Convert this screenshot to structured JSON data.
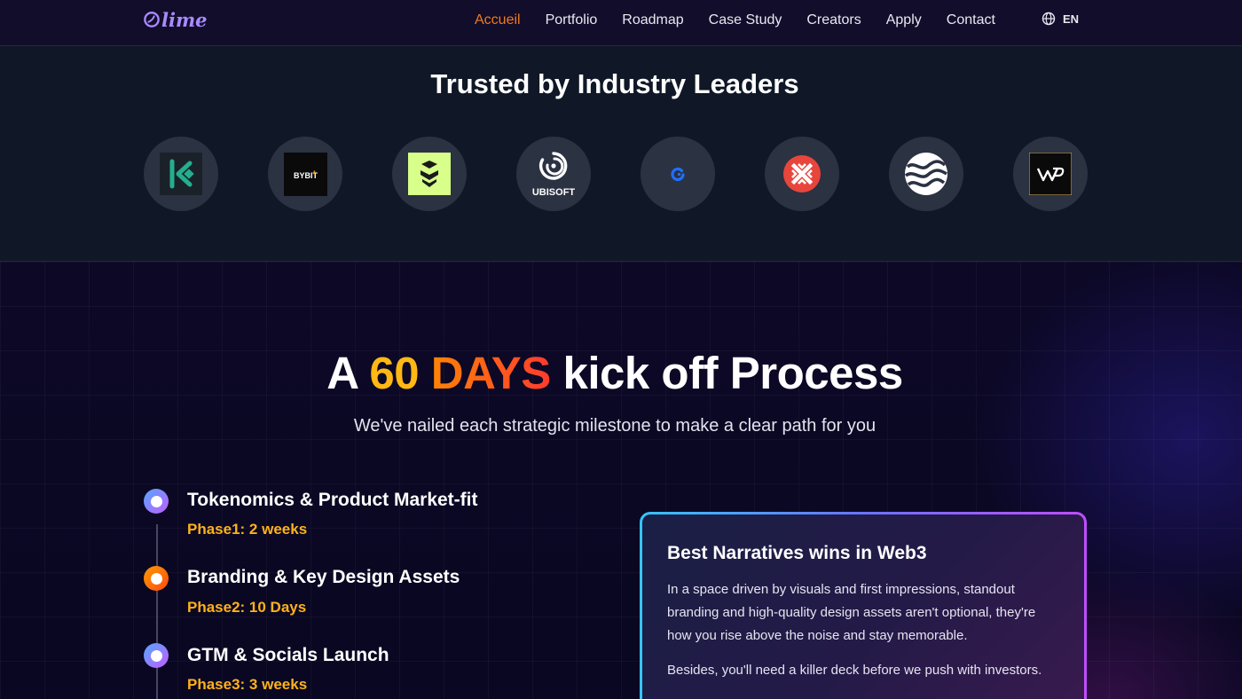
{
  "nav": {
    "logo": "lime",
    "links": [
      {
        "label": "Accueil",
        "active": true
      },
      {
        "label": "Portfolio"
      },
      {
        "label": "Roadmap"
      },
      {
        "label": "Case Study"
      },
      {
        "label": "Creators"
      },
      {
        "label": "Apply"
      },
      {
        "label": "Contact"
      }
    ],
    "language": {
      "icon": "globe-icon",
      "label": "EN"
    }
  },
  "trusted": {
    "title": "Trusted by Industry Leaders",
    "partners": [
      {
        "name": "kucoin-logo"
      },
      {
        "name": "bybit-logo",
        "text": "BYBIT"
      },
      {
        "name": "layered-chevron-logo"
      },
      {
        "name": "ubisoft-logo",
        "text": "UBISOFT"
      },
      {
        "name": "blue-ring-logo"
      },
      {
        "name": "red-x-logo"
      },
      {
        "name": "waves-logo"
      },
      {
        "name": "wp-monogram-logo"
      }
    ]
  },
  "process": {
    "headline": {
      "prefix": "A ",
      "num": "60",
      "days": " DAYS",
      "suffix": " kick off Process"
    },
    "subtitle": "We've nailed each strategic milestone to make a clear path for you",
    "steps": [
      {
        "title": "Tokenomics & Product Market-fit",
        "phase": "Phase1: 2 weeks",
        "color": "purple"
      },
      {
        "title": "Branding & Key Design Assets",
        "phase": "Phase2: 10 Days",
        "color": "orange"
      },
      {
        "title": "GTM & Socials Launch",
        "phase": "Phase3: 3 weeks",
        "color": "purple"
      }
    ],
    "card": {
      "title": "Best Narratives wins in Web3",
      "paragraph1": "In a space driven by visuals and first impressions, standout branding and high-quality design assets aren't optional, they're how you rise above the noise and stay memorable.",
      "paragraph2": "Besides, you'll need a killer deck before we push with investors."
    }
  },
  "colors": {
    "accent_orange": "#f07a1c",
    "phase_yellow": "#ffb21a",
    "nav_bg": "#120d2a",
    "trusted_bg": "#101827",
    "process_bg": "#0b0820"
  }
}
